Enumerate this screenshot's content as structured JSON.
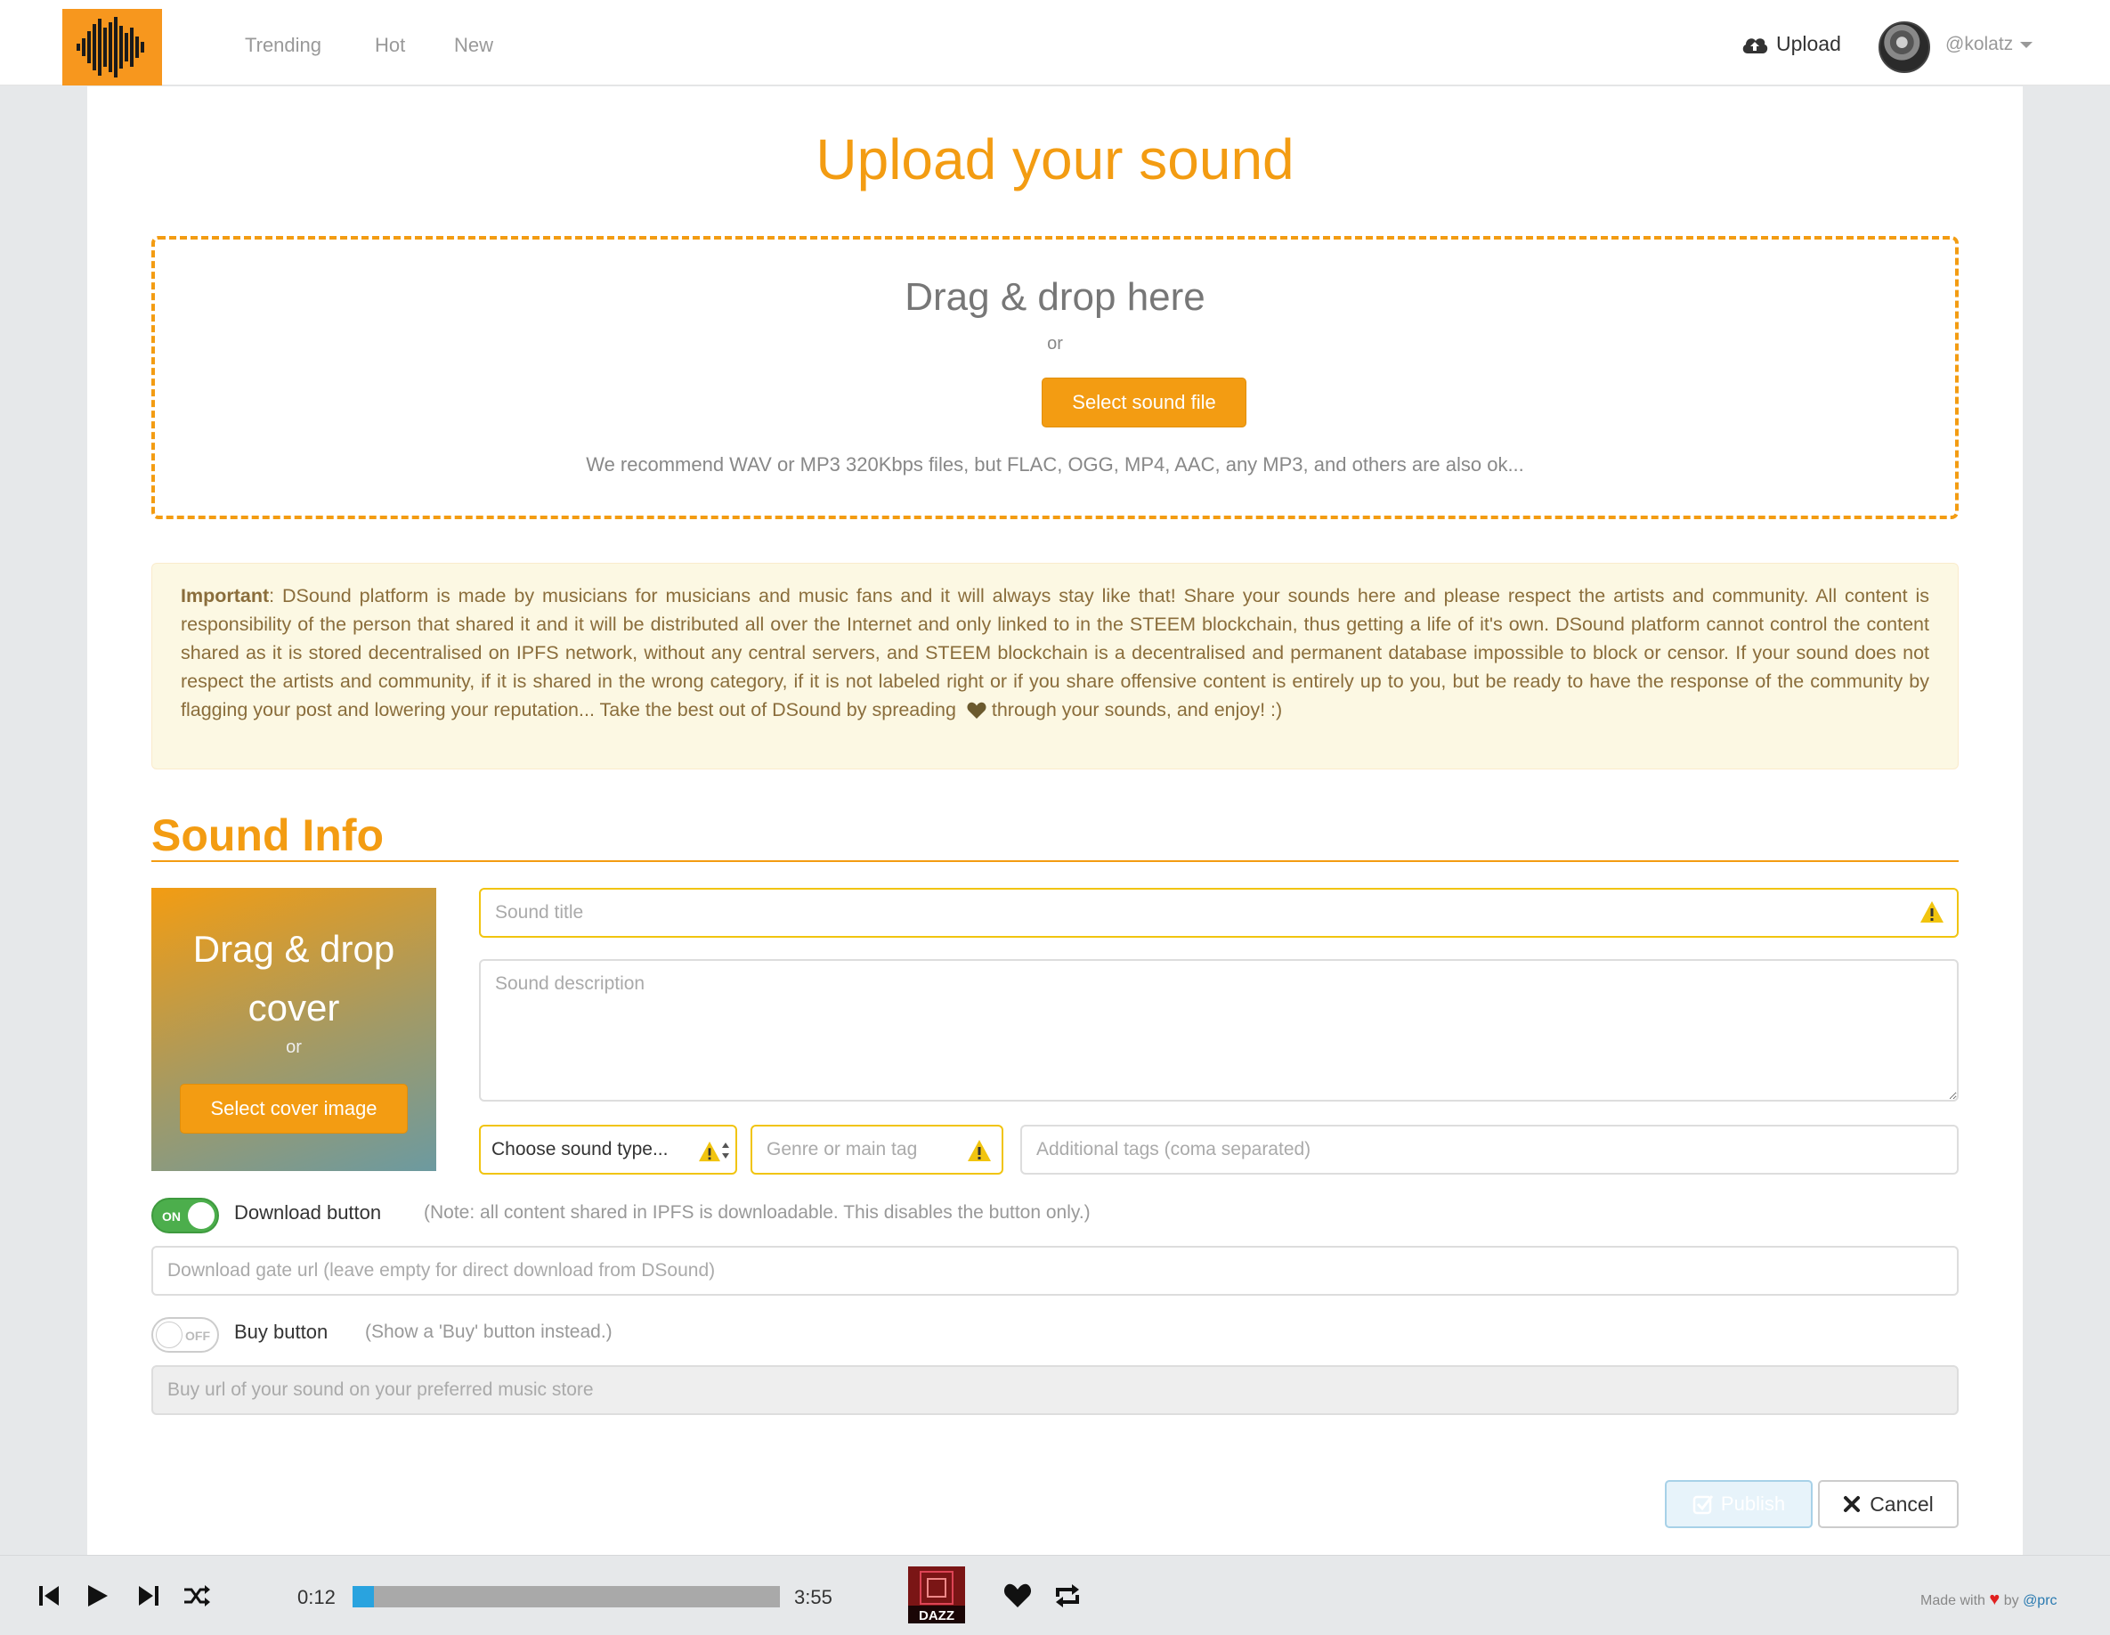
{
  "nav": {
    "links": [
      "Trending",
      "Hot",
      "New"
    ],
    "upload_label": "Upload",
    "username": "@kolatz"
  },
  "page": {
    "title": "Upload your sound"
  },
  "dropzone": {
    "title": "Drag & drop here",
    "or": "or",
    "button": "Select sound file",
    "hint": "We recommend WAV or MP3 320Kbps files, but FLAC, OGG, MP4, AAC, any MP3, and others are also ok..."
  },
  "alert": {
    "label": "Important",
    "text_before_heart": ": DSound platform is made by musicians for musicians and music fans and it will always stay like that! Share your sounds here and please respect the artists and community. All content is responsibility of the person that shared it and it will be distributed all over the Internet and only linked to in the STEEM blockchain, thus getting a life of it's own. DSound platform cannot control the content shared as it is stored decentralised on IPFS network, without any central servers, and STEEM blockchain is a decentralised and permanent database impossible to block or censor. If your sound does not respect the artists and community, if it is shared in the wrong category, if it is not labeled right or if you share offensive content is entirely up to you, but be ready to have the response of the community by flagging your post and lowering your reputation... Take the best out of DSound by spreading",
    "text_after_heart": " through your sounds, and enjoy! :)"
  },
  "sound_info": {
    "title": "Sound Info",
    "cover": {
      "title": "Drag & drop cover",
      "or": "or",
      "button": "Select cover image"
    },
    "title_placeholder": "Sound title",
    "description_placeholder": "Sound description",
    "type_select": "Choose sound type...",
    "genre_placeholder": "Genre or main tag",
    "tags_placeholder": "Additional tags (coma separated)",
    "download": {
      "toggle_state": "ON",
      "label": "Download button",
      "note": "(Note: all content shared in IPFS is downloadable. This disables the button only.)",
      "placeholder": "Download gate url (leave empty for direct download from DSound)"
    },
    "buy": {
      "toggle_state": "OFF",
      "label": "Buy button",
      "note": "(Show a 'Buy' button instead.)",
      "placeholder": "Buy url of your sound on your preferred music store"
    },
    "publish": "Publish",
    "cancel": "Cancel"
  },
  "player": {
    "current_time": "0:12",
    "total_time": "3:55",
    "progress_fraction": 0.051,
    "album_label": "DAZZ",
    "made_with": "Made with",
    "by": "by",
    "author": "@prc"
  },
  "colors": {
    "accent": "#f39c12",
    "warning": "#f1c40f",
    "toggle_on": "#4cae4c",
    "progress": "#29a3df"
  }
}
